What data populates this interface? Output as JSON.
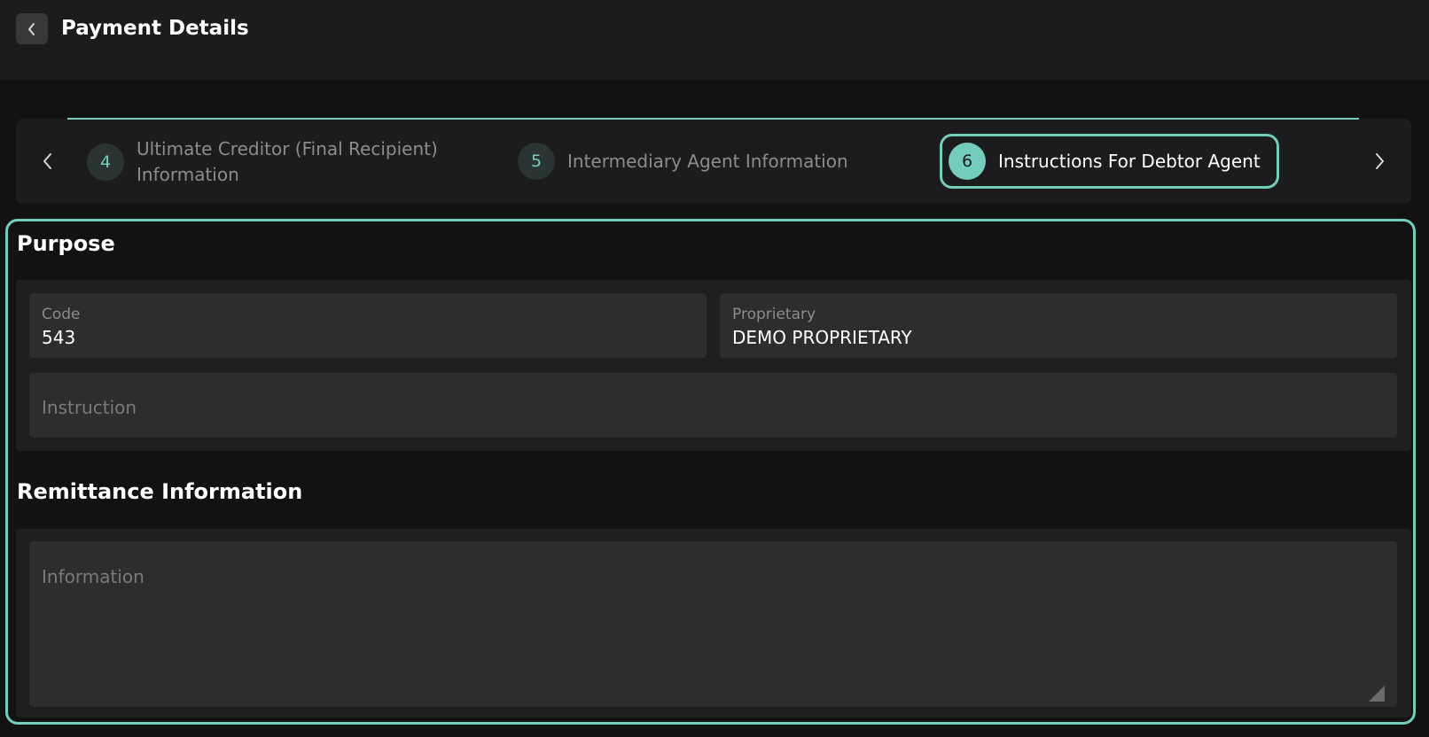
{
  "header": {
    "title": "Payment Details",
    "back_icon": "chevron-left-icon"
  },
  "stepper": {
    "prev_icon": "chevron-left-icon",
    "next_icon": "chevron-right-icon",
    "steps": [
      {
        "number": "4",
        "label_line1": "Ultimate Creditor (Final Recipient)",
        "label_line2": "Information",
        "active": false
      },
      {
        "number": "5",
        "label": "Intermediary Agent Information",
        "active": false
      },
      {
        "number": "6",
        "label": "Instructions For Debtor Agent",
        "active": true
      }
    ]
  },
  "purpose": {
    "title": "Purpose",
    "code": {
      "label": "Code",
      "value": "543"
    },
    "proprietary": {
      "label": "Proprietary",
      "value": "DEMO PROPRIETARY"
    },
    "instruction": {
      "placeholder": "Instruction"
    }
  },
  "remittance": {
    "title": "Remittance Information",
    "information": {
      "placeholder": "Information"
    }
  },
  "colors": {
    "accent": "#74cdbc",
    "background": "#121212",
    "surface": "#1c1c1e",
    "field": "#2d2d2d"
  }
}
